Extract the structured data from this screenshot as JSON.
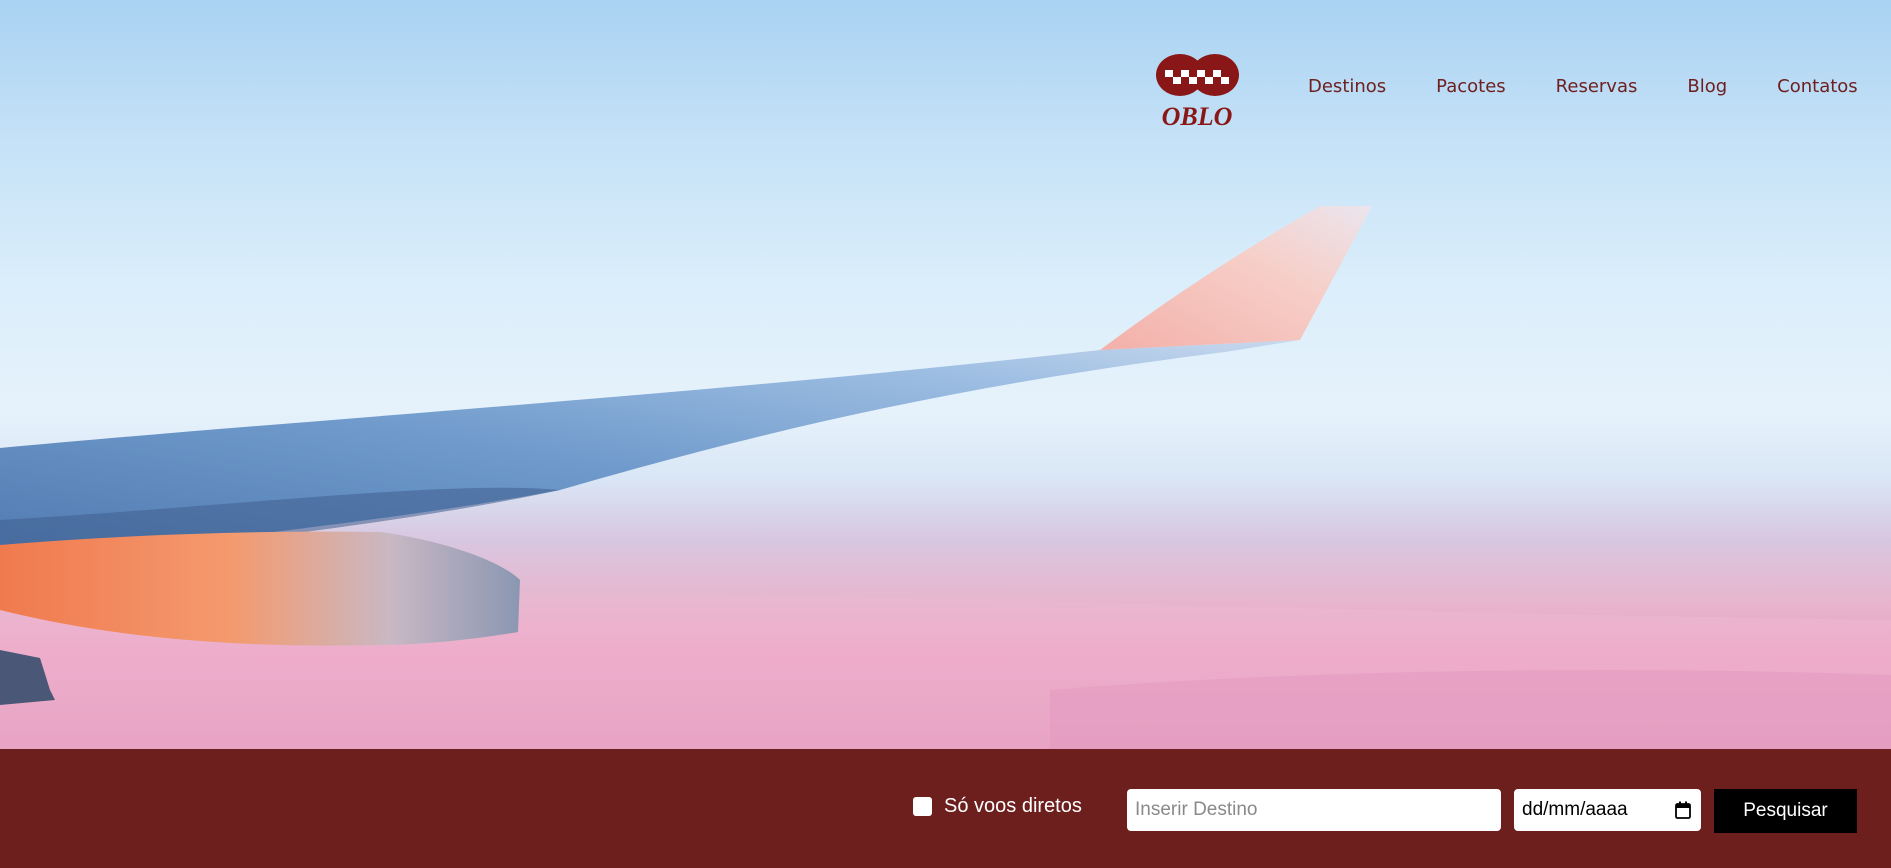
{
  "header": {
    "logo_text": "OBLO",
    "nav": [
      {
        "label": "Destinos"
      },
      {
        "label": "Pacotes"
      },
      {
        "label": "Reservas"
      },
      {
        "label": "Blog"
      },
      {
        "label": "Contatos"
      }
    ]
  },
  "search": {
    "direct_flights_label": "Só voos diretos",
    "destination_placeholder": "Inserir Destino",
    "date_placeholder": "dd/mm/aaaa",
    "button_label": "Pesquisar"
  },
  "colors": {
    "brand": "#6c1f1d",
    "nav_text": "#6e2020",
    "button": "#000000"
  },
  "icons": {
    "calendar": "calendar-icon",
    "logo": "oblo-logo-icon"
  }
}
